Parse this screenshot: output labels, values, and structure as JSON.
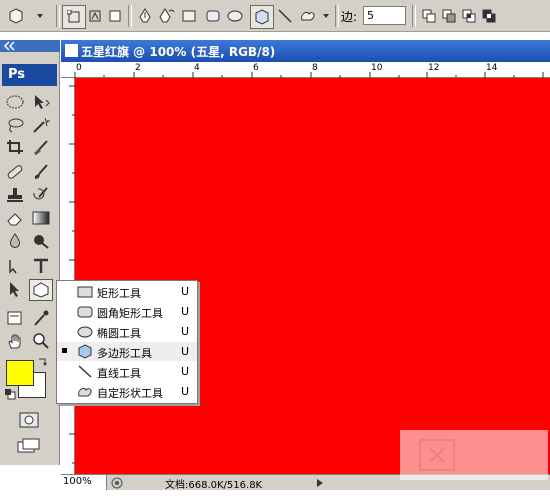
{
  "options_bar": {
    "tools": [
      "polygon-preset",
      "shape-layers",
      "paths",
      "fill-pixels",
      "pen",
      "freeform-pen",
      "rectangle",
      "rounded-rectangle",
      "ellipse",
      "polygon",
      "line",
      "custom-shape"
    ],
    "sides_label": "边:",
    "sides_value": "5"
  },
  "toolbox": {
    "logo": "Ps",
    "foreground_color": "#ffff00",
    "background_color": "#ffffff"
  },
  "document": {
    "title": "五星红旗 @ 100% (五星, RGB/8)",
    "ruler_ticks": [
      "0",
      "2",
      "4",
      "6",
      "8",
      "10",
      "12",
      "14"
    ],
    "canvas_color": "#ff0000",
    "zoom": "100%",
    "doc_info": "文档:668.0K/516.8K"
  },
  "flyout": {
    "items": [
      {
        "label": "矩形工具",
        "key": "U",
        "icon": "rectangle-icon"
      },
      {
        "label": "圆角矩形工具",
        "key": "U",
        "icon": "rounded-rectangle-icon"
      },
      {
        "label": "椭圆工具",
        "key": "U",
        "icon": "ellipse-icon"
      },
      {
        "label": "多边形工具",
        "key": "U",
        "icon": "polygon-icon"
      },
      {
        "label": "直线工具",
        "key": "U",
        "icon": "line-icon"
      },
      {
        "label": "自定形状工具",
        "key": "U",
        "icon": "custom-shape-icon"
      }
    ],
    "active_index": 3
  }
}
